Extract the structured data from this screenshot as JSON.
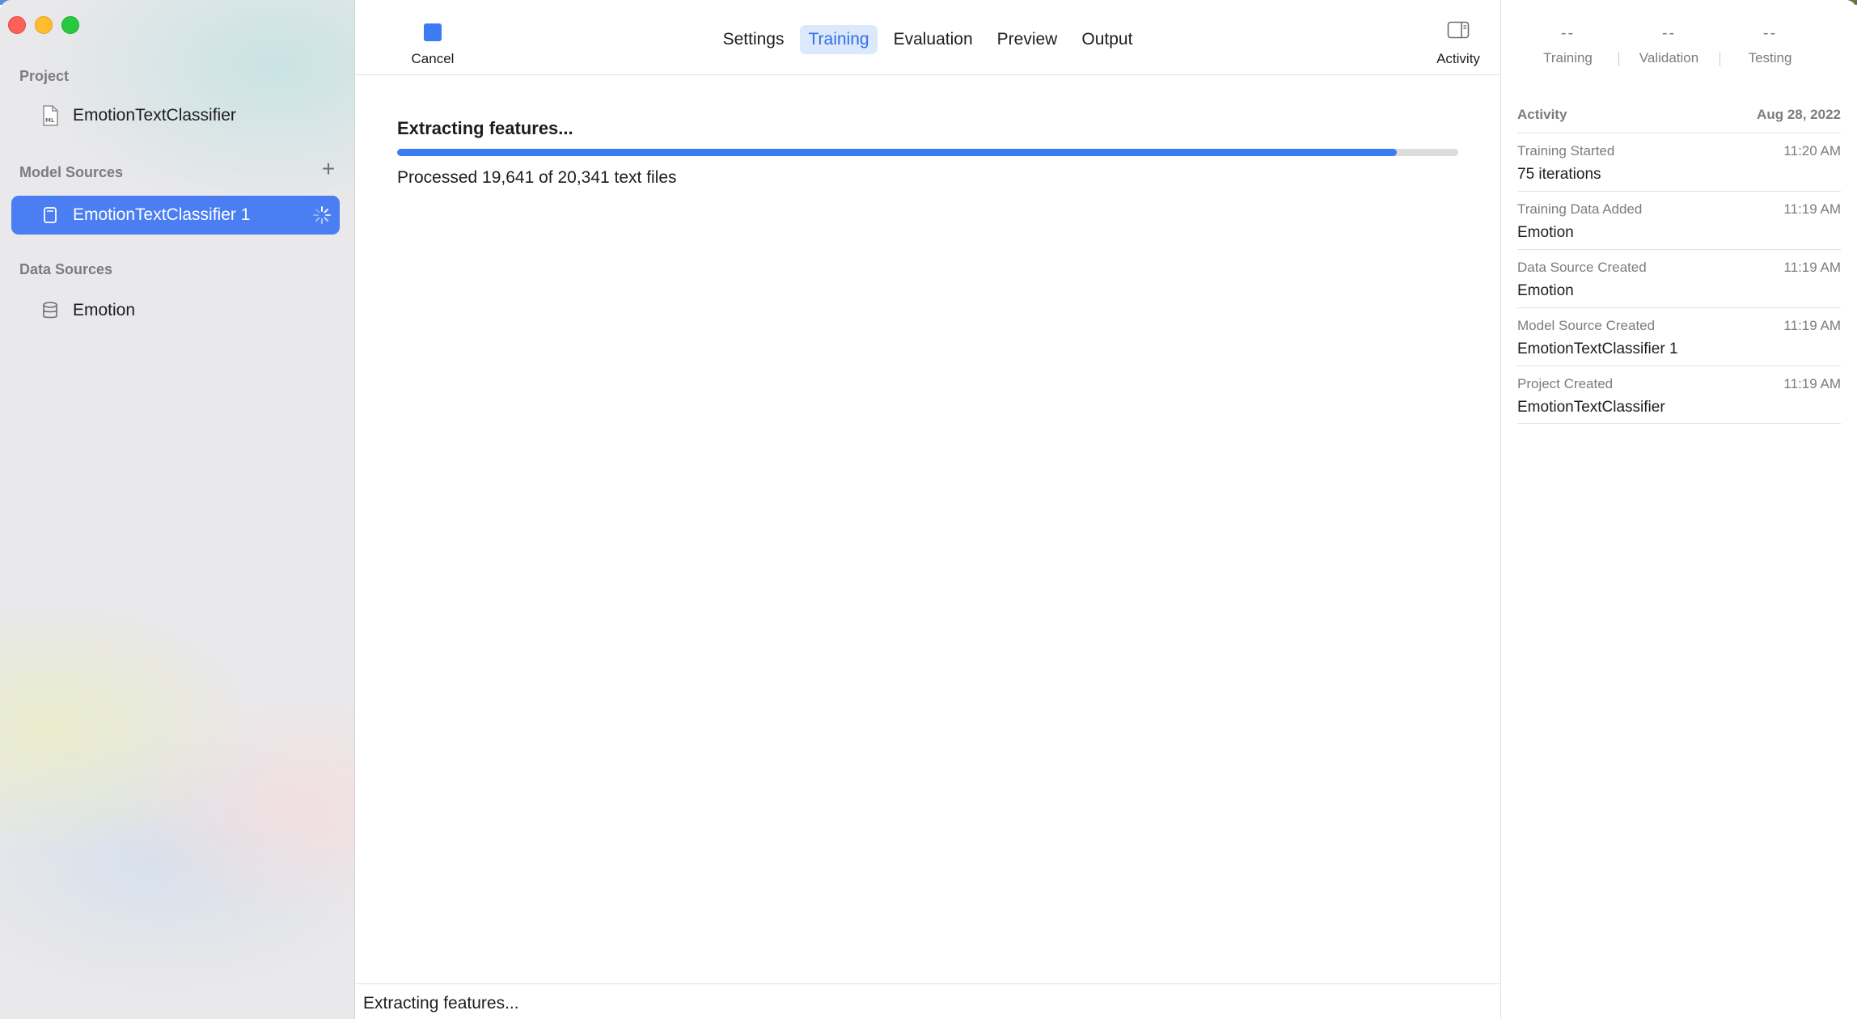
{
  "sidebar": {
    "project_header": "Project",
    "project_item": "EmotionTextClassifier",
    "model_sources_header": "Model Sources",
    "model_source_item": "EmotionTextClassifier 1",
    "data_sources_header": "Data Sources",
    "data_source_item": "Emotion"
  },
  "toolbar": {
    "cancel_label": "Cancel",
    "tabs": [
      {
        "label": "Settings"
      },
      {
        "label": "Training"
      },
      {
        "label": "Evaluation"
      },
      {
        "label": "Preview"
      },
      {
        "label": "Output"
      }
    ],
    "active_tab": "Training",
    "activity_label": "Activity"
  },
  "main": {
    "title": "Extracting features...",
    "progress_fraction": 0.942,
    "progress_text": "Processed 19,641 of 20,341 text files"
  },
  "status_bar": {
    "text": "Extracting features..."
  },
  "inspector": {
    "metrics": [
      {
        "value": "--",
        "label": "Training"
      },
      {
        "value": "--",
        "label": "Validation"
      },
      {
        "value": "--",
        "label": "Testing"
      }
    ],
    "activity_header": "Activity",
    "activity_date": "Aug 28, 2022",
    "activities": [
      {
        "title": "Training Started",
        "time": "11:20 AM",
        "detail": "75 iterations"
      },
      {
        "title": "Training Data Added",
        "time": "11:19 AM",
        "detail": "Emotion"
      },
      {
        "title": "Data Source Created",
        "time": "11:19 AM",
        "detail": "Emotion"
      },
      {
        "title": "Model Source Created",
        "time": "11:19 AM",
        "detail": "EmotionTextClassifier 1"
      },
      {
        "title": "Project Created",
        "time": "11:19 AM",
        "detail": "EmotionTextClassifier"
      }
    ]
  },
  "colors": {
    "accent": "#3b7cf3",
    "selection": "#4a7ef2",
    "active_tab_bg": "#dce8fc",
    "close": "#fe5f57",
    "minimize": "#febc2e",
    "maximize": "#28c840"
  },
  "icons": {
    "project_item": "mlmodel-file-icon",
    "model_source_item": "model-document-icon",
    "data_source_item": "database-icon",
    "add_model_source": "plus-icon",
    "training_status": "spinner-icon",
    "cancel": "stop-square-icon",
    "activity": "sidebar-right-icon"
  }
}
